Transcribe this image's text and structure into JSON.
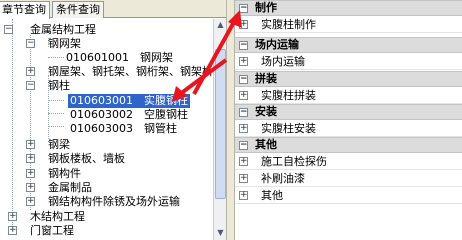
{
  "tabs": [
    {
      "label": "章节查询"
    },
    {
      "label": "条件查询"
    }
  ],
  "tree": {
    "root": {
      "label": "金属结构工程"
    },
    "items": [
      {
        "label": "钢网架"
      },
      {
        "label": "010601001　钢网架"
      },
      {
        "label": "钢屋架、钢托架、钢桁架、钢架桥"
      },
      {
        "label": "钢柱"
      },
      {
        "label": "010603001　实腹钢柱"
      },
      {
        "label": "010603002　空腹钢柱"
      },
      {
        "label": "010603003　钢管柱"
      },
      {
        "label": "钢梁"
      },
      {
        "label": "钢板楼板、墙板"
      },
      {
        "label": "钢构件"
      },
      {
        "label": "金属制品"
      },
      {
        "label": "钢结构构件除锈及场外运输"
      },
      {
        "label": "木结构工程"
      },
      {
        "label": "门窗工程"
      }
    ]
  },
  "panel": {
    "groups": [
      {
        "title": "制作",
        "rows": [
          "实腹柱制作"
        ]
      },
      {
        "title": "场内运输",
        "rows": [
          "场内运输"
        ]
      },
      {
        "title": "拼装",
        "rows": [
          "实腹柱拼装"
        ]
      },
      {
        "title": "安装",
        "rows": [
          "实腹柱安装"
        ]
      },
      {
        "title": "其他",
        "rows": [
          "施工自检探伤",
          "补刷油漆",
          "其他"
        ]
      }
    ]
  },
  "colors": {
    "arrow": "#e8141e",
    "selection": "#2f65c9"
  }
}
